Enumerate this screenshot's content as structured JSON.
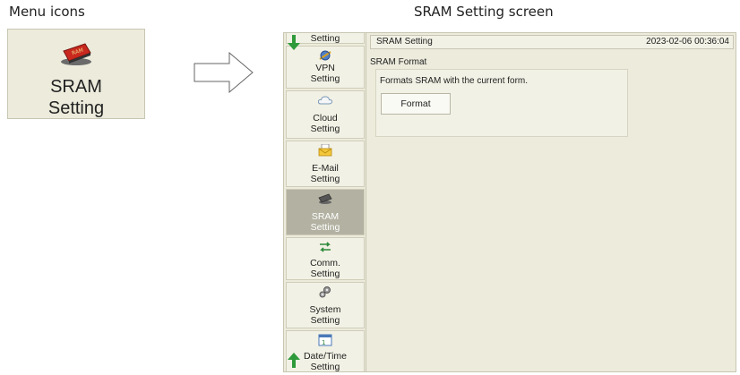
{
  "captions": {
    "left": "Menu icons",
    "right": "SRAM Setting screen"
  },
  "menu_icon": {
    "line1": "SRAM",
    "line2": "Setting",
    "icon": "sram-card-icon"
  },
  "sidebar": {
    "items": [
      {
        "line1": "Setting",
        "line2": "",
        "icon": ""
      },
      {
        "line1": "VPN",
        "line2": "Setting",
        "icon": "vpn-icon"
      },
      {
        "line1": "Cloud",
        "line2": "Setting",
        "icon": "cloud-icon"
      },
      {
        "line1": "E-Mail",
        "line2": "Setting",
        "icon": "email-icon"
      },
      {
        "line1": "SRAM",
        "line2": "Setting",
        "icon": "sram-card-icon",
        "selected": true
      },
      {
        "line1": "Comm.",
        "line2": "Setting",
        "icon": "comm-icon"
      },
      {
        "line1": "System",
        "line2": "Setting",
        "icon": "gear-icon"
      },
      {
        "line1": "Date/Time",
        "line2": "Setting",
        "icon": "calendar-icon"
      }
    ]
  },
  "screen": {
    "title": "SRAM Setting",
    "datetime": "2023-02-06  00:36:04",
    "section_label": "SRAM Format",
    "description": "Formats SRAM with the current form.",
    "format_button": "Format"
  },
  "colors": {
    "panel_bg": "#ecebdc",
    "selected_bg": "#b3b2a2",
    "scroll_arrow": "#2e9a3a"
  }
}
